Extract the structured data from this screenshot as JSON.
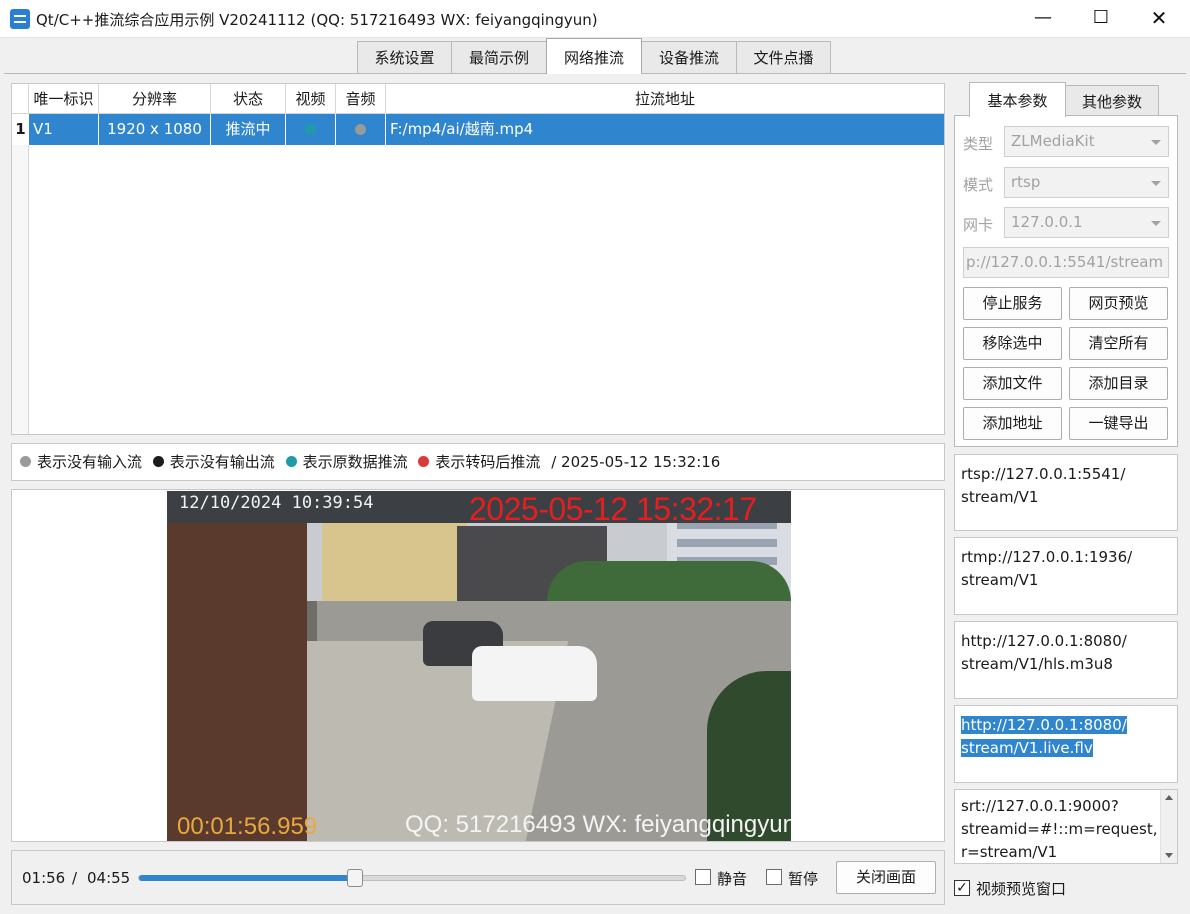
{
  "window": {
    "title": "Qt/C++推流综合应用示例 V20241112 (QQ: 517216493 WX: feiyangqingyun)",
    "minimize_symbol": "—",
    "maximize_symbol": "☐",
    "close_symbol": "✕",
    "app_icon": "app-icon"
  },
  "tabs": [
    "系统设置",
    "最简示例",
    "网络推流",
    "设备推流",
    "文件点播"
  ],
  "active_tab": "网络推流",
  "table": {
    "headers": [
      "唯一标识",
      "分辨率",
      "状态",
      "视频",
      "音频",
      "拉流地址"
    ],
    "rows": [
      {
        "num": "1",
        "id": "V1",
        "resolution": "1920 x 1080",
        "status": "推流中",
        "video_color": "#1f9aa8",
        "audio_color": "#9a9a9a",
        "url": "F:/mp4/ai/越南.mp4"
      }
    ]
  },
  "legend": {
    "items": [
      {
        "color": "#9a9a9a",
        "text": "表示没有输入流"
      },
      {
        "color": "#1c1c1c",
        "text": "表示没有输出流"
      },
      {
        "color": "#1f9aa8",
        "text": "表示原数据推流"
      },
      {
        "color": "#d8393b",
        "text": "表示转码后推流"
      }
    ],
    "separator": "/",
    "datetime": "2025-05-12 15:32:16"
  },
  "video": {
    "osd_camera_time": "12/10/2024 10:39:54",
    "osd_now": "2025-05-12 15:32:17",
    "osd_position": "00:01:56.959",
    "osd_contact": "QQ: 517216493 WX: feiyangqingyun"
  },
  "playbar": {
    "current": "01:56",
    "separator": "/",
    "total": "04:55",
    "progress_fraction": 0.394,
    "mute_label": "静音",
    "pause_label": "暂停",
    "close_label": "关闭画面"
  },
  "right_panel": {
    "tabs": [
      "基本参数",
      "其他参数"
    ],
    "active_tab": "基本参数",
    "type_label": "类型",
    "type_value": "ZLMediaKit",
    "mode_label": "模式",
    "mode_value": "rtsp",
    "nic_label": "网卡",
    "nic_value": "127.0.0.1",
    "push_url": "p://127.0.0.1:5541/stream",
    "buttons": [
      "停止服务",
      "网页预览",
      "移除选中",
      "清空所有",
      "添加文件",
      "添加目录",
      "添加地址",
      "一键导出"
    ]
  },
  "urls": [
    "rtsp://127.0.0.1:5541/stream/V1",
    "rtmp://127.0.0.1:1936/stream/V1",
    "http://127.0.0.1:8080/stream/V1/hls.m3u8",
    "http://127.0.0.1:8080/stream/V1.live.flv",
    "srt://127.0.0.1:9000?streamid=#!::m=request,r=stream/V1"
  ],
  "url_lines": {
    "rtsp": [
      "rtsp://127.0.0.1:5541/",
      "stream/V1"
    ],
    "rtmp": [
      "rtmp://127.0.0.1:1936/",
      "stream/V1"
    ],
    "hls": [
      "http://127.0.0.1:8080/",
      "stream/V1/hls.m3u8"
    ],
    "flv": [
      "http://127.0.0.1:8080/",
      "stream/V1.live.flv"
    ],
    "srt": [
      "srt://127.0.0.1:9000?",
      "streamid=#!::m=request,",
      "r=stream/V1"
    ]
  },
  "preview_checkbox": {
    "label": "视频预览窗口",
    "checked": true,
    "mark": "✓"
  }
}
